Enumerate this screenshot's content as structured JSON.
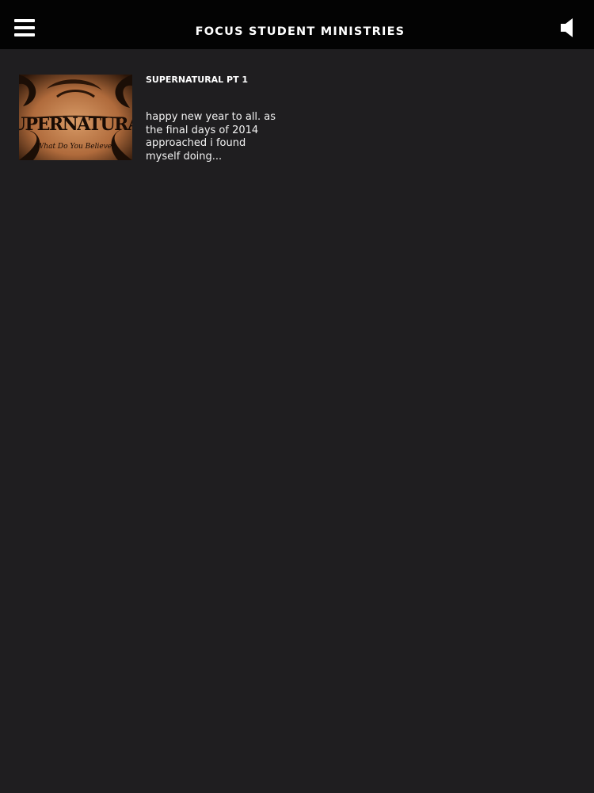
{
  "header": {
    "menu_icon": "hamburger-menu-icon",
    "title": "FOCUS STUDENT MINISTRIES",
    "audio_icon": "speaker-icon"
  },
  "articles": [
    {
      "title": "SUPERNATURAL PT 1",
      "excerpt": "happy new year to all. as the final days of 2014 approached i found myself doing...",
      "thumbnail": {
        "title_text": "SUPERNATURAL",
        "subtitle_text": "What Do You Believe?"
      }
    }
  ],
  "colors": {
    "background": "#1f1e20",
    "header_background": "#030303",
    "text": "#ffffff"
  }
}
